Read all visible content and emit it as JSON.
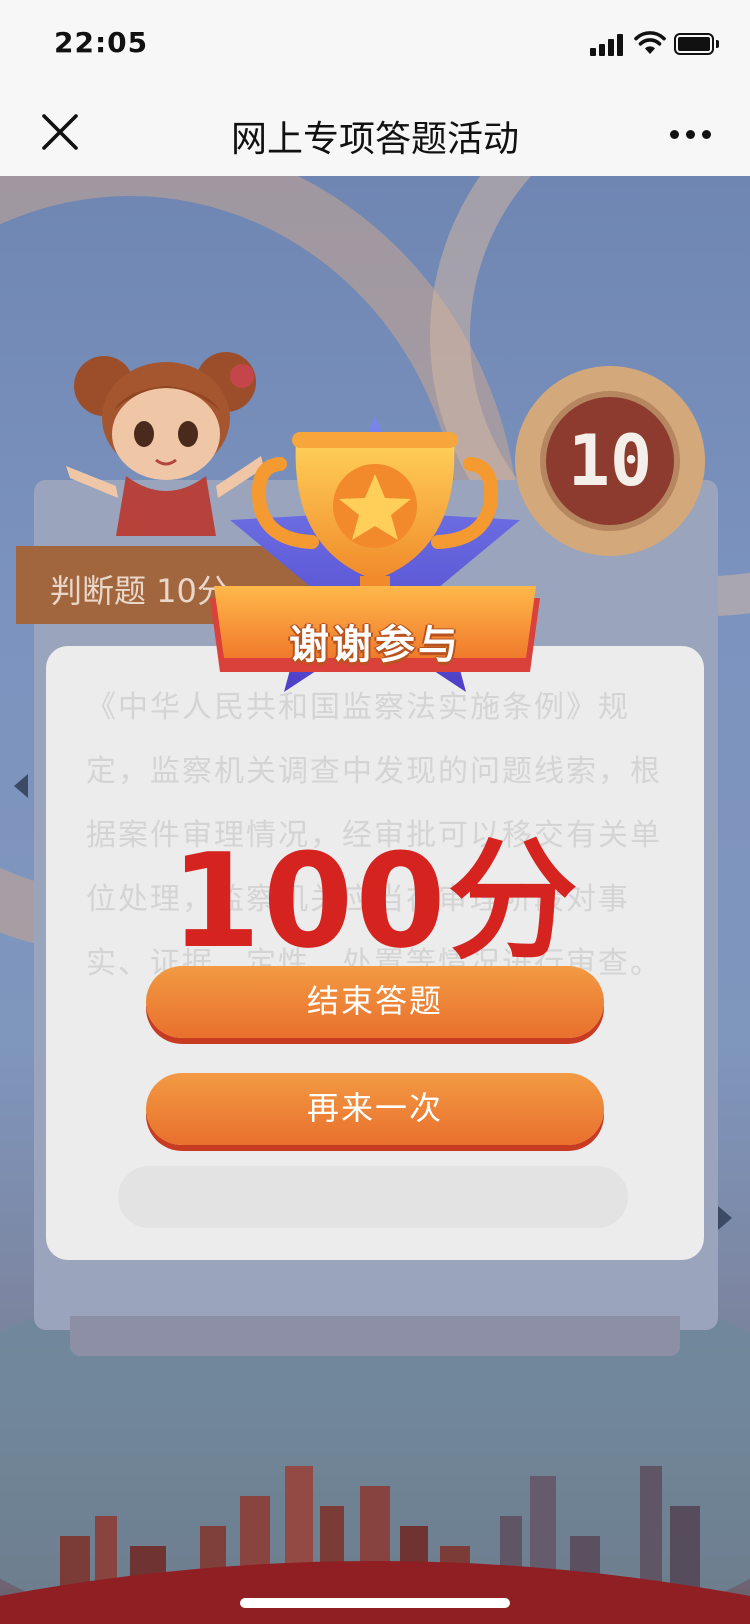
{
  "status_bar": {
    "time": "22:05"
  },
  "nav": {
    "title": "网上专项答题活动"
  },
  "background": {
    "question_type": "判断题 10分",
    "question_number": "10",
    "question_text": "《中华人民共和国监察法实施条例》规定，监察机关调查中发现的问题线索，根据案件审理情况，经审批可以移交有关单位处理，监察机关应当在审理阶段对事实、证据、定性、处置等情况进行审查。"
  },
  "result": {
    "banner": "谢谢参与",
    "score": "100分",
    "buttons": {
      "end_label": "结束答题",
      "again_label": "再来一次"
    }
  },
  "colors": {
    "accent": "#e9702d",
    "score": "#d5231f",
    "star": "#5b57d9",
    "trophy": "#f3a23a"
  }
}
